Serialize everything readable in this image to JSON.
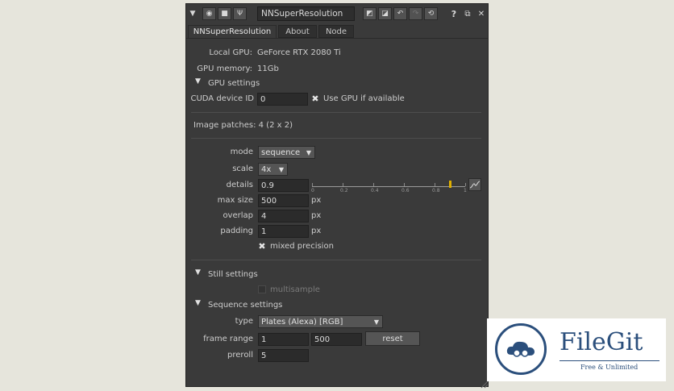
{
  "toolbar": {
    "node_name": "NNSuperResolution",
    "help": "?",
    "icons": [
      "menu-triangle",
      "settings",
      "clapper",
      "wrench",
      "bypass-left",
      "bypass-right",
      "undo",
      "redo",
      "revert",
      "help",
      "float",
      "close"
    ]
  },
  "tabs": [
    {
      "label": "NNSuperResolution",
      "active": true
    },
    {
      "label": "About",
      "active": false
    },
    {
      "label": "Node",
      "active": false
    }
  ],
  "info": {
    "local_gpu_label": "Local GPU:",
    "local_gpu_value": "GeForce RTX 2080 Ti",
    "gpu_memory_label": "GPU memory:",
    "gpu_memory_value": "11Gb"
  },
  "gpu_settings": {
    "title": "GPU settings",
    "cuda_label": "CUDA device ID",
    "cuda_value": "0",
    "use_gpu_label": "Use GPU if available",
    "use_gpu_checked": true
  },
  "image_patches": "Image patches: 4 (2 x 2)",
  "params": {
    "mode_label": "mode",
    "mode_value": "sequence",
    "scale_label": "scale",
    "scale_value": "4x",
    "details_label": "details",
    "details_value": "0.9",
    "slider_ticks": [
      "0",
      "0.2",
      "0.4",
      "0.6",
      "0.8",
      "1"
    ],
    "slider_value": 0.9,
    "max_size_label": "max size",
    "max_size_value": "500",
    "overlap_label": "overlap",
    "overlap_value": "4",
    "padding_label": "padding",
    "padding_value": "1",
    "unit_px": "px",
    "mixed_precision_label": "mixed precision",
    "mixed_precision_checked": true
  },
  "still_settings": {
    "title": "Still settings",
    "multisample_label": "multisample",
    "multisample_checked": false
  },
  "sequence_settings": {
    "title": "Sequence settings",
    "type_label": "type",
    "type_value": "Plates (Alexa) [RGB]",
    "frame_range_label": "frame range",
    "frame_start": "1",
    "frame_end": "500",
    "reset_label": "reset",
    "preroll_label": "preroll",
    "preroll_value": "5"
  },
  "watermark": {
    "name": "FileGit",
    "tagline": "Free & Unlimited"
  },
  "colors": {
    "panel_bg": "#3a3a3a",
    "slider_handle": "#e0b000",
    "watermark": "#2b4f7c"
  }
}
